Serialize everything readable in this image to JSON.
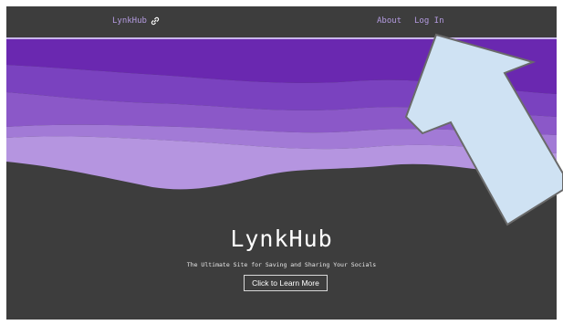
{
  "navbar": {
    "brand": "LynkHub",
    "brand_icon": "link-icon",
    "about": "About",
    "login": "Log In"
  },
  "hero": {
    "title": "LynkHub",
    "subtitle": "The Ultimate Site for Saving and Sharing Your Socials",
    "button": "Click to Learn More"
  },
  "colors": {
    "background": "#3d3d3d",
    "accent": "#b49be0",
    "wave_dark": "#6a28b0",
    "wave_light": "#c2a6e8",
    "arrow_fill": "#cfe2f3"
  }
}
